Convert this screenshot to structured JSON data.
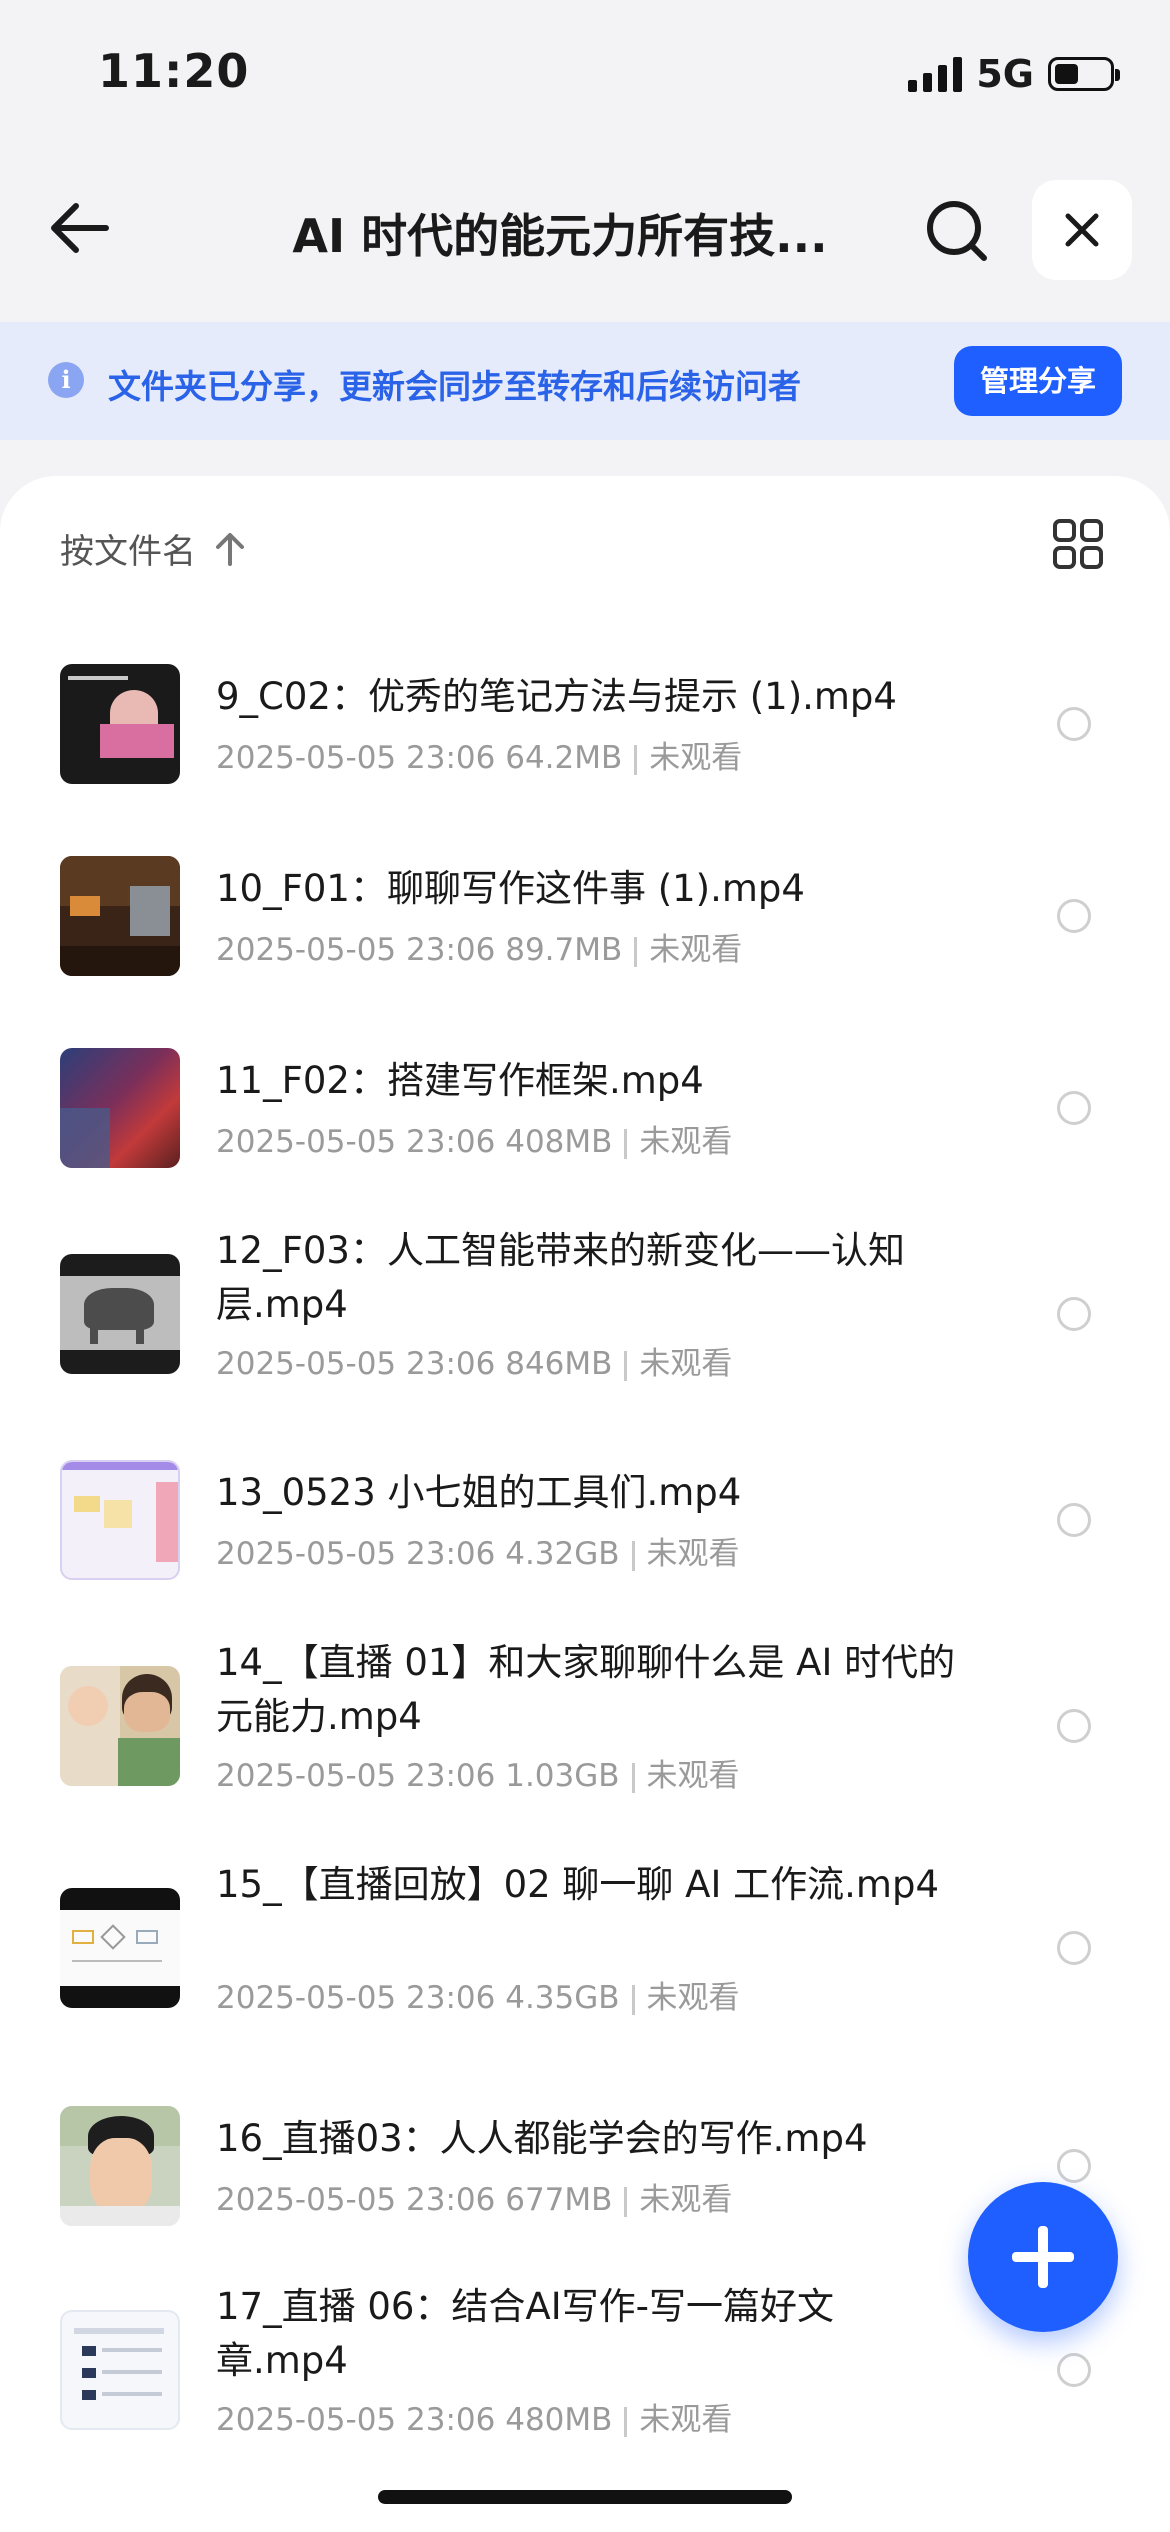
{
  "status_bar": {
    "time": "11:20",
    "network": "5G",
    "battery_level": 0.45
  },
  "nav": {
    "title": "AI 时代的能元力所有技...",
    "back_icon": "arrow-left-icon",
    "search_icon": "search-icon",
    "close_icon": "close-icon"
  },
  "banner": {
    "text": "文件夹已分享，更新会同步至转存和后续访问者",
    "manage_label": "管理分享",
    "icon": "info-icon"
  },
  "sort": {
    "label": "按文件名",
    "direction_icon": "arrow-up-icon",
    "view_icon": "grid-view-icon"
  },
  "files": [
    {
      "name": "9_C02：优秀的笔记方法与提示 (1).mp4",
      "date": "2025-05-05 23:06",
      "size": "64.2MB",
      "status": "未观看"
    },
    {
      "name": "10_F01：聊聊写作这件事 (1).mp4",
      "date": "2025-05-05 23:06",
      "size": "89.7MB",
      "status": "未观看"
    },
    {
      "name": "11_F02：搭建写作框架.mp4",
      "date": "2025-05-05 23:06",
      "size": "408MB",
      "status": "未观看"
    },
    {
      "name": "12_F03：人工智能带来的新变化——认知层.mp4",
      "date": "2025-05-05 23:06",
      "size": "846MB",
      "status": "未观看"
    },
    {
      "name": "13_0523 小七姐的工具们.mp4",
      "date": "2025-05-05 23:06",
      "size": "4.32GB",
      "status": "未观看"
    },
    {
      "name": "14_【直播 01】和大家聊聊什么是 AI 时代的元能力.mp4",
      "date": "2025-05-05 23:06",
      "size": "1.03GB",
      "status": "未观看"
    },
    {
      "name": "15_【直播回放】02 聊一聊 AI 工作流.mp4",
      "date": "2025-05-05 23:06",
      "size": "4.35GB",
      "status": "未观看"
    },
    {
      "name": "16_直播03：人人都能学会的写作.mp4",
      "date": "2025-05-05 23:06",
      "size": "677MB",
      "status": "未观看"
    },
    {
      "name": "17_直播 06：结合AI写作-写一篇好文章.mp4",
      "date": "2025-05-05 23:06",
      "size": "480MB",
      "status": "未观看"
    }
  ],
  "fab": {
    "icon": "plus-icon"
  }
}
